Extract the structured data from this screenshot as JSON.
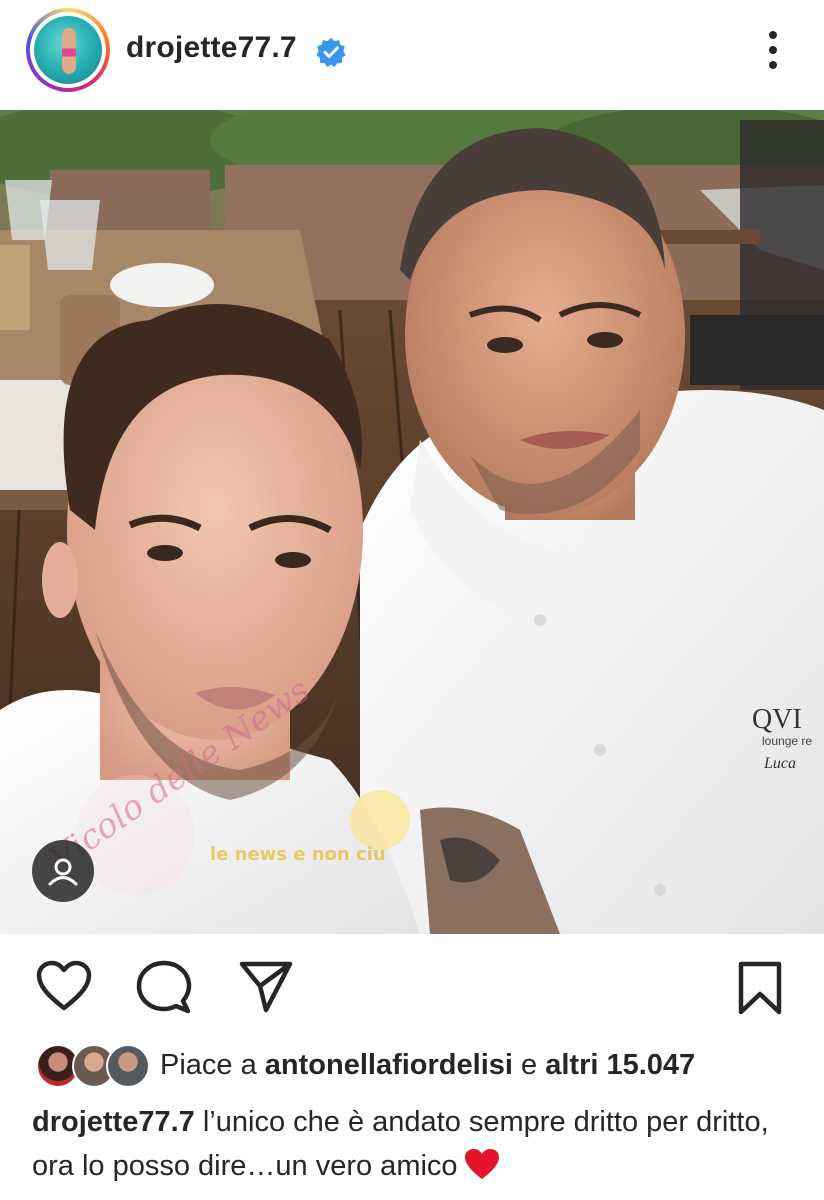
{
  "post": {
    "username": "drojette77.7",
    "verified": true,
    "more_icon": "more-vertical-icon",
    "photo_icon": "tagged-people-icon"
  },
  "actions": {
    "like_icon": "heart-outline-icon",
    "comment_icon": "comment-bubble-icon",
    "share_icon": "paper-plane-icon",
    "save_icon": "bookmark-outline-icon"
  },
  "likes": {
    "prefix": "Piace a",
    "liked_by": "antonellafiordelisi",
    "connector": "e",
    "others": "altri 15.047"
  },
  "caption": {
    "username": "drojette77.7",
    "text": "l’unico che è andato sempre dritto per dritto, ora lo posso dire…un vero amico",
    "emoji": "red-heart-icon"
  },
  "photo_watermarks": {
    "left": "Vicolo delle News",
    "center": "le news e non ciu"
  },
  "jacket_logo": {
    "brand": "QVI",
    "sub": "lounge re",
    "name": "Luca"
  },
  "colors": {
    "verified_blue": "#3797f0",
    "text": "#262626",
    "heart_red": "#e2152a"
  }
}
